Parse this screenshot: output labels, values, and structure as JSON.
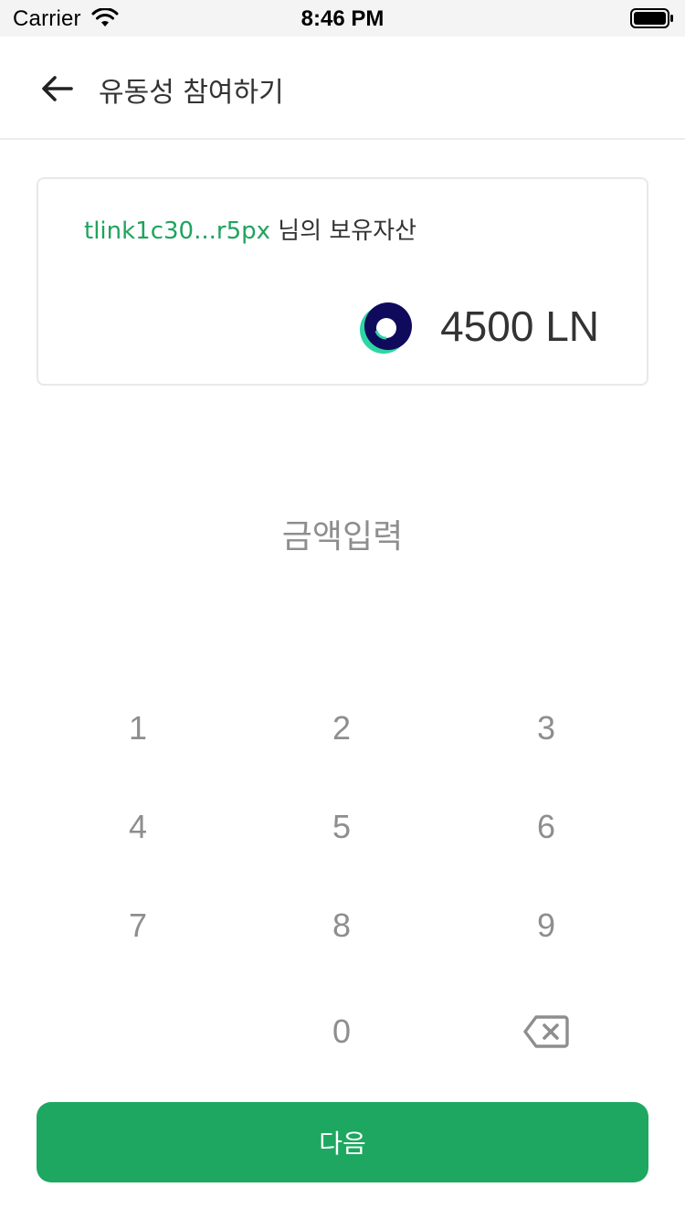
{
  "status_bar": {
    "carrier": "Carrier",
    "time": "8:46 PM"
  },
  "header": {
    "title": "유동성 참여하기"
  },
  "asset_card": {
    "address": "tlink1c30...r5px",
    "suffix": " 님의 보유자산",
    "balance": "4500 LN"
  },
  "amount_input": {
    "placeholder": "금액입력"
  },
  "keypad": {
    "keys": [
      "1",
      "2",
      "3",
      "4",
      "5",
      "6",
      "7",
      "8",
      "9",
      "0"
    ]
  },
  "next_button": {
    "label": "다음"
  },
  "colors": {
    "accent": "#1ea760",
    "address_green": "#1fa35e",
    "text": "#333333",
    "muted": "#8e8e8e"
  }
}
